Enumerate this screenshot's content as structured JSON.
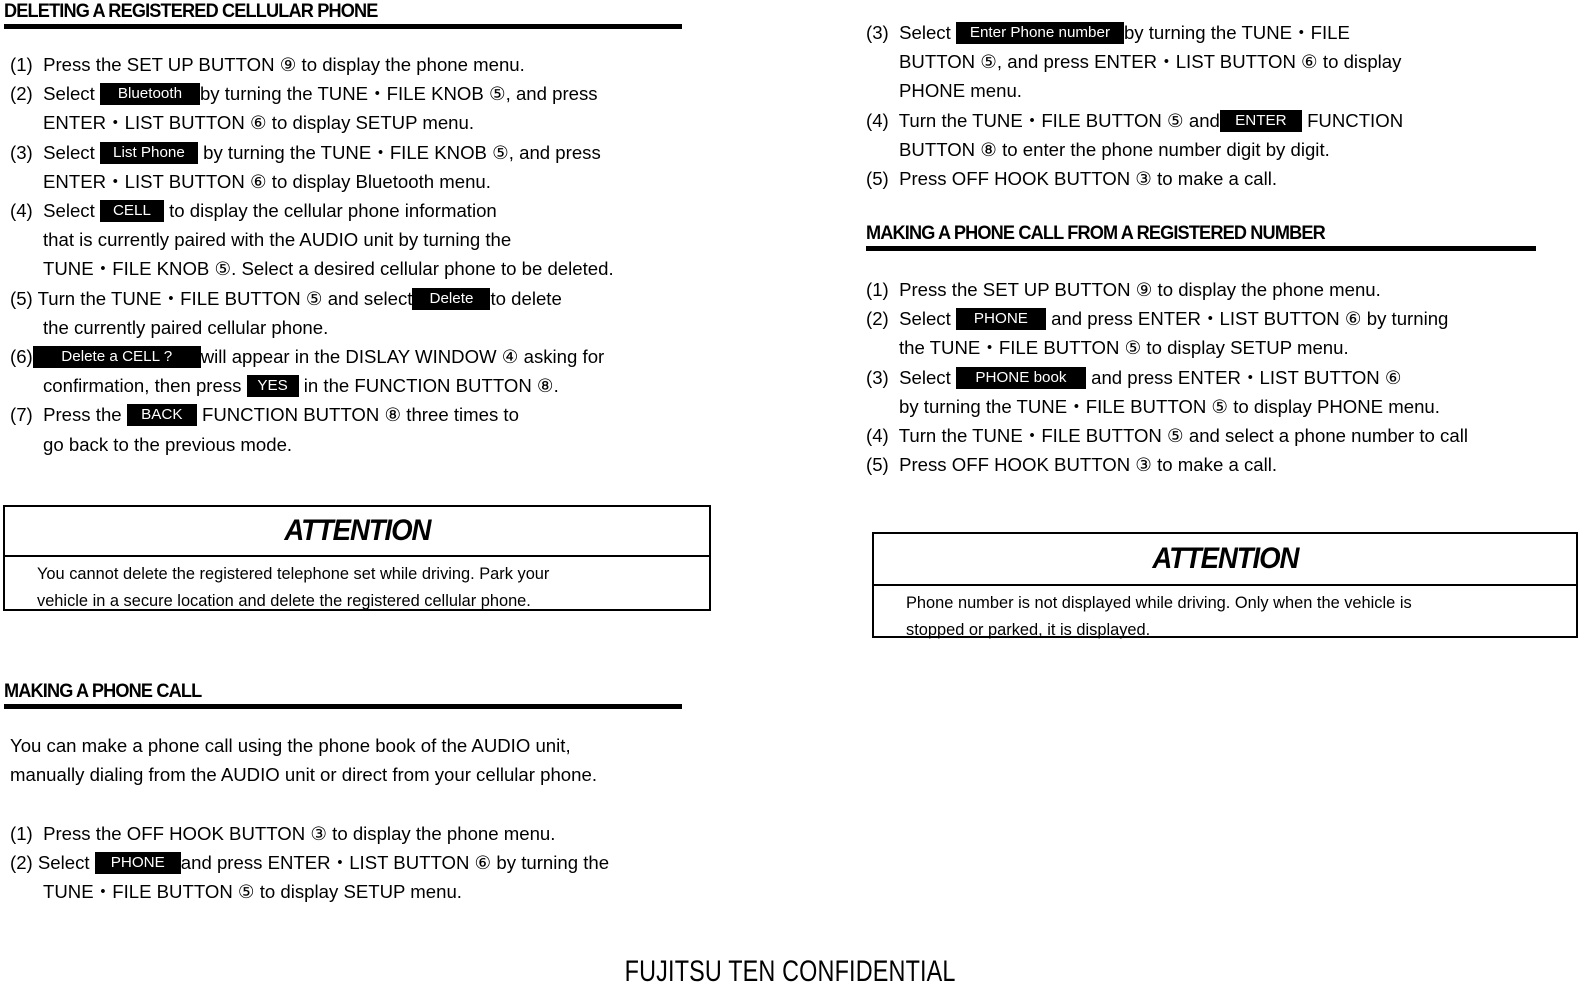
{
  "document": {
    "footer": "FUJITSU TEN CONFIDENTIAL"
  },
  "left_column": {
    "section1": {
      "title": "DELETING A REGISTERED CELLULAR PHONE",
      "steps": [
        {
          "num": "(1)",
          "lines": [
            "Press the SET UP BUTTON ⑨ to display the phone menu."
          ]
        },
        {
          "num": "(2)",
          "lines": [
            "Select ",
            " by turning the TUNE・FILE KNOB ⑤, and press",
            "ENTER・LIST BUTTON ⑥ to display SETUP menu."
          ],
          "chip": "Bluetooth"
        },
        {
          "num": "(3)",
          "lines": [
            "Select ",
            " by turning the TUNE・FILE KNOB ⑤, and press",
            "ENTER・LIST BUTTON ⑥ to display Bluetooth menu."
          ],
          "chip": "List Phone"
        },
        {
          "num": "(4)",
          "lines": [
            "Select ",
            " to display the cellular phone information",
            "that is currently paired with the AUDIO unit by turning the",
            "TUNE・FILE KNOB ⑤. Select a desired cellular phone to be deleted."
          ],
          "chip": "CELL"
        },
        {
          "num": "(5)",
          "lines": [
            "Turn the TUNE・FILE BUTTON ⑤ and select",
            "to delete",
            "the currently paired cellular phone."
          ],
          "chip": "Delete"
        },
        {
          "num": "(6)",
          "lines": [
            "will appear in the DISLAY WINDOW ④ asking for",
            "confirmation, then press ",
            " in the FUNCTION BUTTON ⑧."
          ],
          "chip": "Delete a CELL ?",
          "chip2": "YES"
        },
        {
          "num": "(7)",
          "lines": [
            "Press the ",
            " FUNCTION BUTTON ⑧ three times to",
            "go back to the previous mode."
          ],
          "chip": "BACK"
        }
      ],
      "step1_text": "Press the SET UP BUTTON ⑨ to display the phone menu.",
      "step2_pre": "Select",
      "step2_chip": "Bluetooth",
      "step2_post": "by turning the TUNE・FILE KNOB ⑤, and press",
      "step2_line2": "ENTER・LIST BUTTON ⑥ to display SETUP menu.",
      "step3_pre": "Select",
      "step3_chip": "List Phone",
      "step3_post": "by turning the TUNE・FILE KNOB ⑤, and press",
      "step3_line2": "ENTER・LIST BUTTON ⑥ to display Bluetooth menu.",
      "step4_pre": "Select",
      "step4_chip": "CELL",
      "step4_post": "to display the cellular phone information",
      "step4_line2": "that is currently paired with the AUDIO unit by turning the",
      "step4_line3": "TUNE・FILE KNOB ⑤. Select a desired cellular phone to be deleted.",
      "step5_pre": "Turn the TUNE・FILE BUTTON ⑤ and select",
      "step5_chip": "Delete",
      "step5_post": "to delete",
      "step5_line2": "the currently paired cellular phone.",
      "step6_chip": "Delete a CELL ?",
      "step6_post": "will appear in the DISLAY WINDOW ④ asking for",
      "step6_line2_pre": "confirmation, then press",
      "step6_chip2": "YES",
      "step6_line2_post": "in the FUNCTION BUTTON ⑧.",
      "step7_pre": "Press the",
      "step7_chip": "BACK",
      "step7_post": "FUNCTION BUTTON ⑧ three times to",
      "step7_line2": "go back to the previous mode.",
      "nums": {
        "n1": "(1)",
        "n2": "(2)",
        "n3": "(3)",
        "n4": "(4)",
        "n5": "(5)",
        "n6": "(6)",
        "n7": "(7)"
      }
    },
    "attention1": {
      "heading": "ATTENTION",
      "line1": "You cannot delete the registered telephone set while driving. Park your",
      "line2": "vehicle in a secure location and delete the registered cellular phone."
    },
    "section2": {
      "title": "MAKING A PHONE CALL",
      "intro_line1": "You can make a phone call using the phone book of the AUDIO unit,",
      "intro_line2": "manually dialing from the AUDIO unit or direct from your cellular phone.",
      "nums": {
        "n1": "(1)",
        "n2": "(2)"
      },
      "step1_text": "Press the OFF HOOK BUTTON ③ to display the phone menu.",
      "step2_pre": "Select",
      "step2_chip": "PHONE",
      "step2_post": "and press ENTER・LIST BUTTON ⑥ by turning the",
      "step2_line2": "TUNE・FILE BUTTON ⑤ to display SETUP menu."
    }
  },
  "right_column": {
    "section1_continued": {
      "nums": {
        "n3": "(3)",
        "n4": "(4)",
        "n5": "(5)"
      },
      "step3_pre": "Select",
      "step3_chip": "Enter Phone number",
      "step3_post": "by turning  the TUNE・FILE",
      "step3_line2": "BUTTON ⑤,  and press ENTER・LIST BUTTON ⑥ to display",
      "step3_line3": "PHONE menu.",
      "step4_pre": "Turn the TUNE・FILE BUTTON ⑤ and",
      "step4_chip": "ENTER",
      "step4_post": "FUNCTION",
      "step4_line2": "BUTTON ⑧ to enter the phone number digit by digit.",
      "step5_text": "Press OFF HOOK BUTTON ③ to make a call."
    },
    "section2": {
      "title": "MAKING A PHONE CALL FROM A REGISTERED NUMBER",
      "nums": {
        "n1": "(1)",
        "n2": "(2)",
        "n3": "(3)",
        "n4": "(4)",
        "n5": "(5)"
      },
      "step1_text": "Press the SET UP BUTTON ⑨ to display the phone menu.",
      "step2_pre": "Select",
      "step2_chip": "PHONE",
      "step2_post": "and press ENTER・LIST BUTTON ⑥ by turning",
      "step2_line2": "the TUNE・FILE BUTTON ⑤ to display SETUP menu.",
      "step3_pre": "Select",
      "step3_chip": "PHONE book",
      "step3_post": "and press ENTER・LIST BUTTON ⑥",
      "step3_line2": "by turning the TUNE・FILE BUTTON ⑤ to display PHONE menu.",
      "step4_text": "Turn the TUNE・FILE BUTTON ⑤ and select a phone number to call",
      "step5_text": "Press OFF HOOK BUTTON ③ to make a call."
    },
    "attention2": {
      "heading": "ATTENTION",
      "line1": "Phone number is not displayed while driving. Only when the vehicle is",
      "line2": "stopped or parked, it is displayed."
    }
  }
}
